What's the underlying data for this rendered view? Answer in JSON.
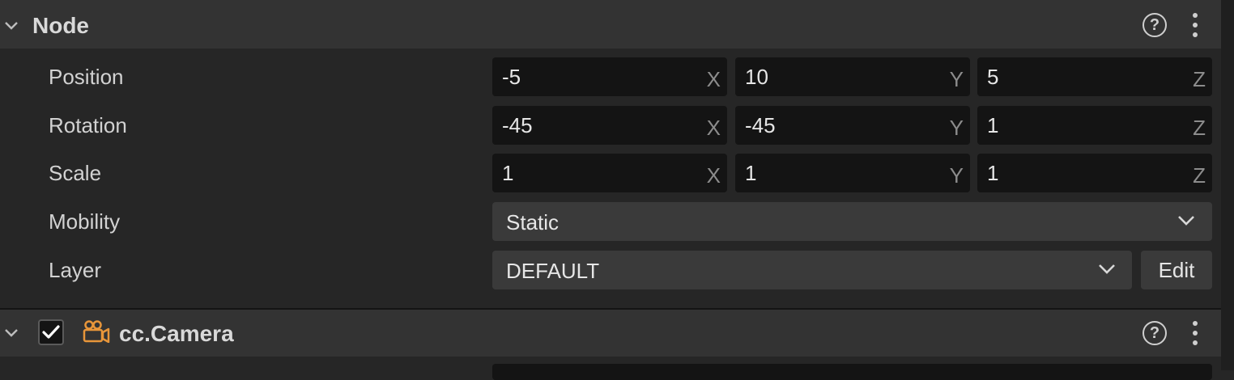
{
  "node_section": {
    "title": "Node",
    "rows": [
      {
        "label": "Position",
        "x": "-5",
        "y": "10",
        "z": "5"
      },
      {
        "label": "Rotation",
        "x": "-45",
        "y": "-45",
        "z": "1"
      },
      {
        "label": "Scale",
        "x": "1",
        "y": "1",
        "z": "1"
      }
    ],
    "axis_labels": {
      "x": "X",
      "y": "Y",
      "z": "Z"
    },
    "mobility": {
      "label": "Mobility",
      "value": "Static"
    },
    "layer": {
      "label": "Layer",
      "value": "DEFAULT",
      "edit_label": "Edit"
    }
  },
  "camera_section": {
    "title": "cc.Camera",
    "enabled": true,
    "icon": "camera-icon"
  },
  "icons": {
    "collapse": "chevron-down-icon",
    "help": "help-icon",
    "more": "kebab-menu-icon"
  },
  "colors": {
    "camera_icon": "#e8963a",
    "background": "#262626",
    "header": "#333333",
    "field": "#141414"
  }
}
